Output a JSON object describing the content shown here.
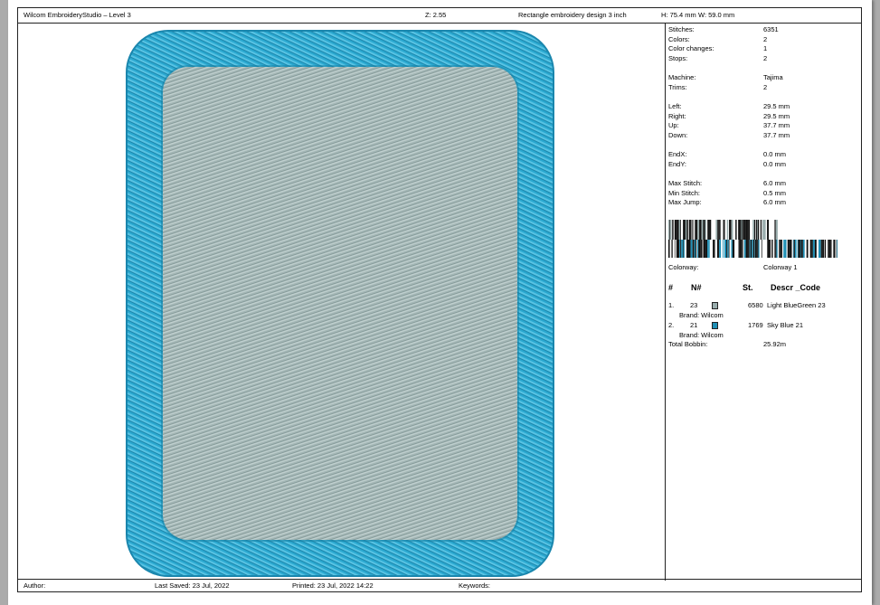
{
  "header": {
    "app_title": "Wilcom EmbroideryStudio – Level 3",
    "zoom": "Z: 2.55",
    "design_name": "Rectangle embroidery design 3 inch",
    "height": "H: 75.4 mm",
    "width": "W: 59.0 mm"
  },
  "footer": {
    "author": "Author:",
    "last_saved": "Last Saved: 23 Jul, 2022",
    "printed": "Printed: 23 Jul, 2022 14:22",
    "keywords": "Keywords:"
  },
  "info": {
    "stats": [
      {
        "label": "Stitches:",
        "value": "6351"
      },
      {
        "label": "Colors:",
        "value": "2"
      },
      {
        "label": "Color changes:",
        "value": "1"
      },
      {
        "label": "Stops:",
        "value": "2"
      },
      {
        "label": "Machine:",
        "value": "Tajima"
      },
      {
        "label": "Trims:",
        "value": "2"
      },
      {
        "label": "Left:",
        "value": "29.5 mm"
      },
      {
        "label": "Right:",
        "value": "29.5 mm"
      },
      {
        "label": "Up:",
        "value": "37.7 mm"
      },
      {
        "label": "Down:",
        "value": "37.7 mm"
      },
      {
        "label": "EndX:",
        "value": "0.0 mm"
      },
      {
        "label": "EndY:",
        "value": "0.0 mm"
      },
      {
        "label": "Max Stitch:",
        "value": "6.0 mm"
      },
      {
        "label": "Min Stitch:",
        "value": "0.5 mm"
      },
      {
        "label": "Max Jump:",
        "value": "6.0 mm"
      }
    ],
    "colorway": {
      "label": "Colorway:",
      "value": "Colorway 1"
    },
    "table_headers": {
      "num": "#",
      "n": "N#",
      "st": "St.",
      "descr": "Descr _Code"
    },
    "threads": [
      {
        "index": "1.",
        "n": "23",
        "stitches": "6580",
        "descr": "Light BlueGreen 23",
        "brand": "Brand: Wilcom",
        "color": "#98acac"
      },
      {
        "index": "2.",
        "n": "21",
        "stitches": "1769",
        "descr": "Sky Blue 21",
        "brand": "Brand: Wilcom",
        "color": "#1f8fb5"
      }
    ],
    "total_bobbin": {
      "label": "Total Bobbin:",
      "value": "25.92m"
    }
  },
  "colors": {
    "fill_thread": "#98acac",
    "border_thread": "#29a7cf"
  }
}
